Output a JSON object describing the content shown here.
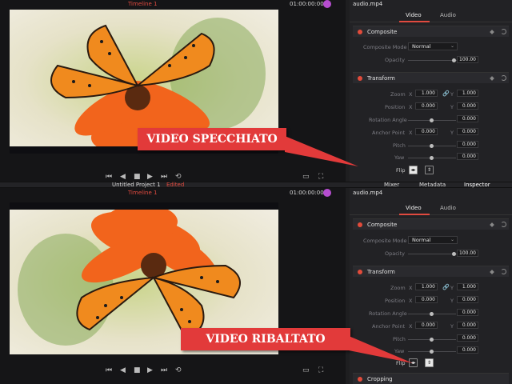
{
  "top": {
    "timeline": "Timeline 1",
    "timecode": "01:00:00:00",
    "clip": "audio.mp4",
    "tabs": [
      "Video",
      "Audio"
    ],
    "composite": {
      "title": "Composite",
      "mode_label": "Composite Mode",
      "mode_value": "Normal",
      "opacity_label": "Opacity",
      "opacity_value": "100.00"
    },
    "transform": {
      "title": "Transform",
      "zoom_label": "Zoom",
      "zoom_x": "1.000",
      "zoom_y": "1.000",
      "position_label": "Position",
      "pos_x": "0.000",
      "pos_y": "0.000",
      "rotation_label": "Rotation Angle",
      "rotation": "0.000",
      "anchor_label": "Anchor Point",
      "anchor_x": "0.000",
      "anchor_y": "0.000",
      "pitch_label": "Pitch",
      "pitch": "0.000",
      "yaw_label": "Yaw",
      "yaw": "0.000",
      "flip_label": "Flip",
      "axis_x": "X",
      "axis_y": "Y"
    },
    "callout": "VIDEO SPECCHIATO"
  },
  "divider": {
    "project": "Untitled Project 1",
    "edited": "Edited",
    "tabs": [
      "Mixer",
      "Metadata",
      "Inspector"
    ]
  },
  "bottom": {
    "timeline": "Timeline 1",
    "timecode": "01:00:00:00",
    "clip": "audio.mp4",
    "tabs": [
      "Video",
      "Audio"
    ],
    "composite": {
      "title": "Composite",
      "mode_label": "Composite Mode",
      "mode_value": "Normal",
      "opacity_label": "Opacity",
      "opacity_value": "100.00"
    },
    "transform": {
      "title": "Transform",
      "zoom_label": "Zoom",
      "zoom_x": "1.000",
      "zoom_y": "1.000",
      "position_label": "Position",
      "pos_x": "0.000",
      "pos_y": "0.000",
      "rotation_label": "Rotation Angle",
      "rotation": "0.000",
      "anchor_label": "Anchor Point",
      "anchor_x": "0.000",
      "anchor_y": "0.000",
      "pitch_label": "Pitch",
      "pitch": "0.000",
      "yaw_label": "Yaw",
      "yaw": "0.000",
      "flip_label": "Flip",
      "axis_x": "X",
      "axis_y": "Y"
    },
    "cropping": "Cropping",
    "callout": "VIDEO RIBALTATO"
  },
  "colors": {
    "accent": "#e04a3f",
    "callout": "#e23a3a",
    "butterfly": "#f08a1e"
  },
  "icons": [
    "skip-back-icon",
    "step-back-icon",
    "stop-icon",
    "play-icon",
    "step-forward-icon",
    "skip-forward-icon",
    "loop-icon",
    "link-icon",
    "reset-icon",
    "keyframe-icon",
    "flip-horizontal-icon",
    "flip-vertical-icon"
  ]
}
